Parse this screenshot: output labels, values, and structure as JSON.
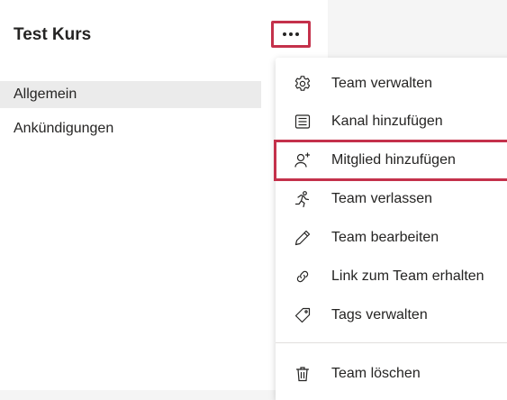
{
  "team": {
    "title": "Test Kurs"
  },
  "channels": [
    {
      "label": "Allgemein",
      "active": true
    },
    {
      "label": "Ankündigungen",
      "active": false
    }
  ],
  "menu": {
    "items": [
      {
        "label": "Team verwalten",
        "icon": "gear-icon"
      },
      {
        "label": "Kanal hinzufügen",
        "icon": "channel-list-icon"
      },
      {
        "label": "Mitglied hinzufügen",
        "icon": "add-person-icon",
        "highlighted": true
      },
      {
        "label": "Team verlassen",
        "icon": "leave-running-person-icon"
      },
      {
        "label": "Team bearbeiten",
        "icon": "pencil-icon"
      },
      {
        "label": "Link zum Team erhalten",
        "icon": "link-icon"
      },
      {
        "label": "Tags verwalten",
        "icon": "tag-icon"
      },
      {
        "label": "Team löschen",
        "icon": "trash-icon"
      }
    ]
  },
  "colors": {
    "highlight_border": "#c4314b",
    "active_channel_bg": "#ebebeb",
    "text": "#252423"
  }
}
